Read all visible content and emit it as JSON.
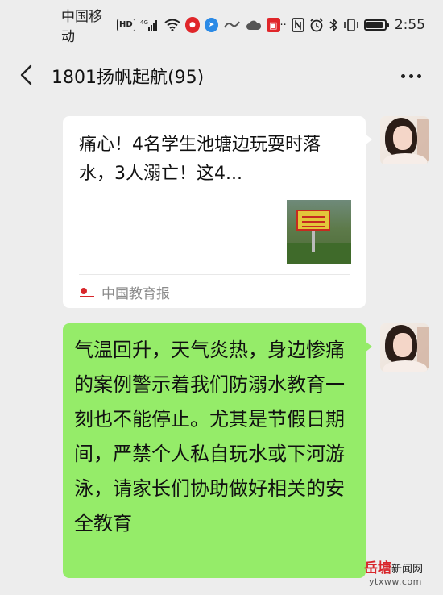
{
  "status_bar": {
    "carrier": "中国移动",
    "hd_badge": "HD",
    "network": "4G",
    "time": "2:55",
    "icons": [
      "hd-icon",
      "signal-icon",
      "wifi-icon",
      "app-notification-icon",
      "telegram-icon",
      "app-notification-icon",
      "cloud-icon",
      "app-notification-icon",
      "nfc-icon",
      "alarm-icon",
      "bluetooth-icon",
      "vibrate-icon",
      "battery-icon"
    ],
    "battery_level": 0.9
  },
  "header": {
    "title": "1801扬帆起航(95)",
    "back_icon": "chevron-left-icon",
    "more_icon": "more-dots-icon"
  },
  "messages": {
    "link_card": {
      "title": "痛心！4名学生池塘边玩耍时落水，3人溺亡！这4...",
      "source": "中国教育报"
    },
    "text_message": {
      "text": "气温回升，天气炎热，身边惨痛的案例警示着我们防溺水教育一刻也不能停止。尤其是节假日期间，严禁个人私自玩水或下河游泳，请家长们协助做好相关的安全教育"
    }
  },
  "watermark": {
    "name_big": "岳塘",
    "name_small": "新闻网",
    "url": "ytxww.com"
  },
  "colors": {
    "background": "#ededed",
    "bubble_green": "#95ec69",
    "card_white": "#ffffff",
    "watermark_red": "#d8262b"
  }
}
